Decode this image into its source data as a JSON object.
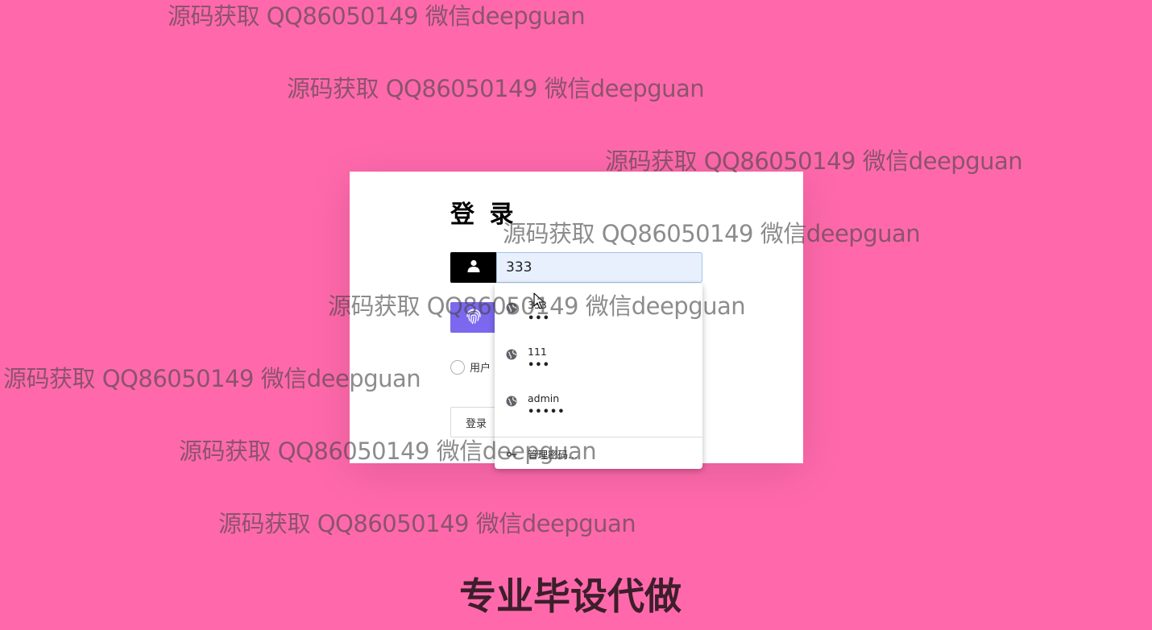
{
  "login": {
    "title": "登 录",
    "username_value": "333",
    "radio_label": "用户",
    "login_button": "登录"
  },
  "autofill": {
    "items": [
      {
        "username": "333",
        "password_mask": "•••"
      },
      {
        "username": "111",
        "password_mask": "•••"
      },
      {
        "username": "admin",
        "password_mask": "•••••"
      }
    ],
    "manage_label": "管理密码..."
  },
  "watermarks": [
    "源码获取 QQ86050149 微信deepguan",
    "源码获取 QQ86050149 微信deepguan",
    "源码获取 QQ86050149 微信deepguan",
    "源码获取 QQ86050149 微信deepguan",
    "源码获取 QQ86050149 微信deepguan",
    "源码获取 QQ86050149 微信deepguan",
    "源码获取 QQ86050149 微信deepguan",
    "源码获取 QQ86050149 微信deepguan"
  ],
  "banner": "专业毕设代做",
  "colors": {
    "background": "#ff69ac",
    "fingerprint_button": "#7b68ee",
    "user_icon_box": "#000000",
    "input_autofill": "#e8f0fe"
  },
  "icons": [
    "user-icon",
    "fingerprint-icon",
    "globe-icon",
    "key-icon",
    "cursor-icon"
  ]
}
